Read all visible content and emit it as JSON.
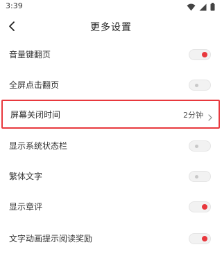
{
  "status": {
    "time": "3:39",
    "icons": [
      "wifi-icon",
      "signal-icon",
      "battery-icon"
    ]
  },
  "header": {
    "title": "更多设置",
    "back_icon": "chevron-left-icon"
  },
  "settings": {
    "volume_page_turn": {
      "label": "音量键翻页",
      "enabled": true
    },
    "fullscreen_tap_turn": {
      "label": "全屏点击翻页",
      "enabled": false
    },
    "screen_off_time": {
      "label": "屏幕关闭时间",
      "value": "2分钟"
    },
    "show_status_bar": {
      "label": "显示系统状态栏",
      "enabled": false
    },
    "traditional_chinese": {
      "label": "繁体文字",
      "enabled": false
    },
    "show_chapter_comments": {
      "label": "显示章评",
      "enabled": true
    },
    "text_animation_reward": {
      "label": "文字动画提示阅读奖励",
      "enabled": true
    }
  },
  "colors": {
    "accent": "#e8383d",
    "toggle_off": "#f2f2f2"
  }
}
